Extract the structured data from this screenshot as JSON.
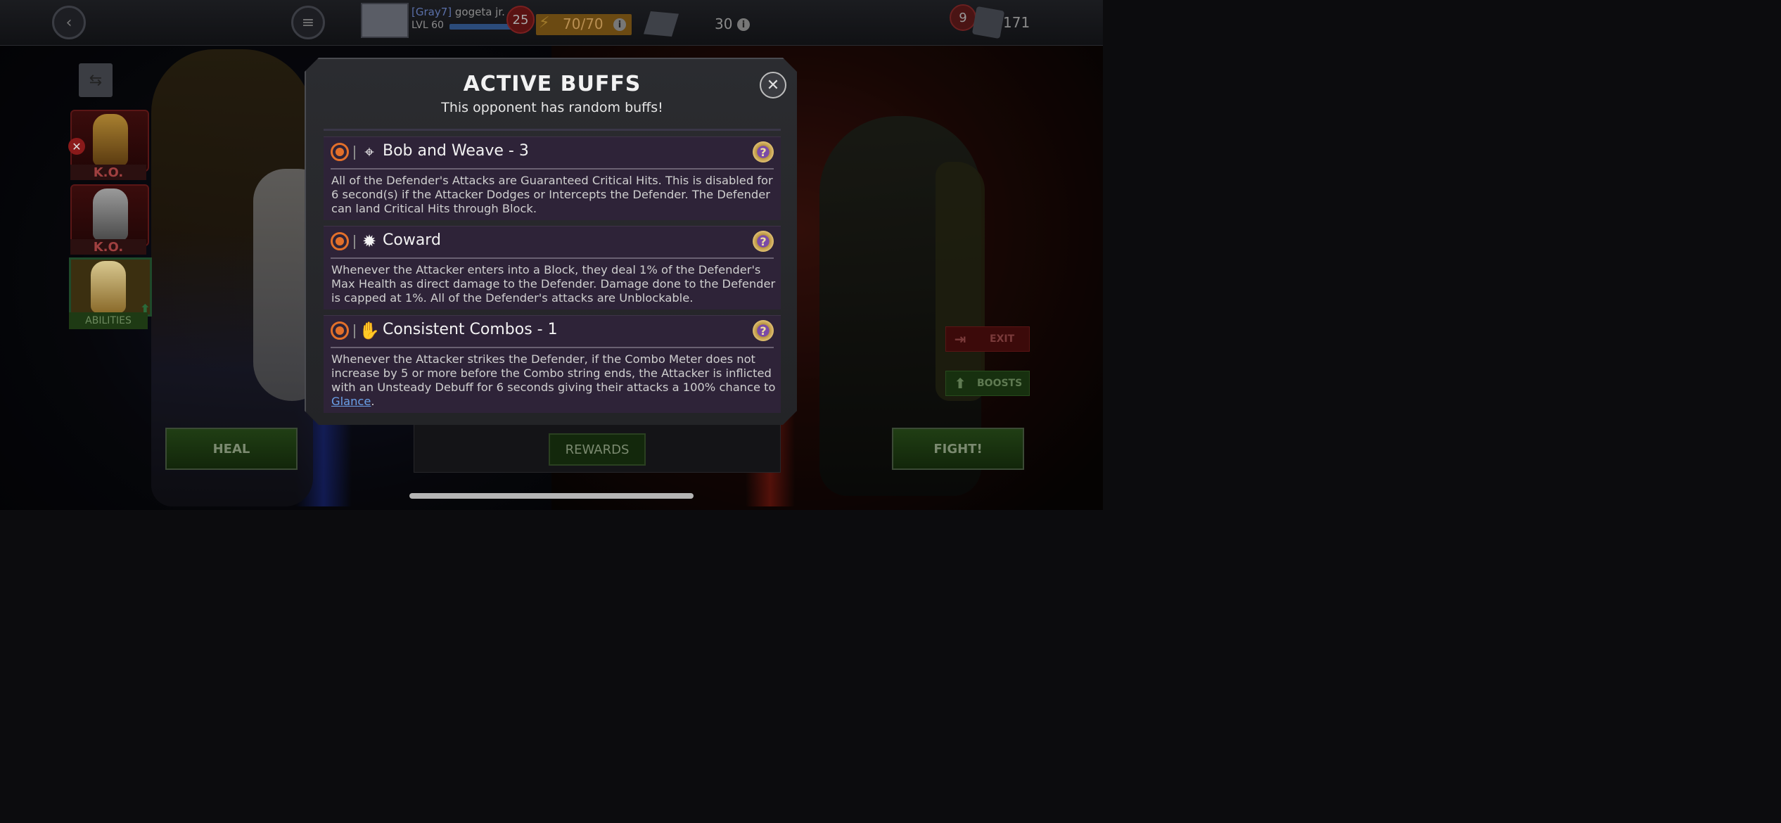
{
  "topbar": {
    "back_icon": "back-arrow-icon",
    "menu_icon": "menu-icon",
    "alliance_tag": "[Gray7]",
    "player_name": "gogeta jr.",
    "level_label": "LVL 60",
    "level_badge": "25",
    "energy": "70/70",
    "units_or_resource": "30",
    "notification_count": "9",
    "gold": "171"
  },
  "roster": {
    "ko_label_1": "K.O.",
    "ko_label_2": "K.O.",
    "abilities_label": "ABILITIES"
  },
  "side_buttons": {
    "exit_label": "EXIT",
    "boosts_label": "BOOSTS"
  },
  "bottom": {
    "heal_label": "HEAL",
    "rewards_label": "REWARDS",
    "fight_label": "FIGHT!"
  },
  "modal": {
    "title": "ACTIVE BUFFS",
    "subtitle": "This opponent has random buffs!",
    "buffs": [
      {
        "name": "Bob and Weave - 3",
        "type_icon": "crosshair-icon",
        "description": "All of the Defender's Attacks are Guaranteed Critical Hits. This is disabled for 6 second(s) if the Attacker Dodges or Intercepts the Defender. The Defender can land Critical Hits through Block."
      },
      {
        "name": "Coward",
        "type_icon": "burst-icon",
        "description": "Whenever the Attacker enters into a Block, they deal 1% of the Defender's Max Health as direct damage to the Defender. Damage done to the Defender is capped at 1%. All of the Defender's attacks are Unblockable."
      },
      {
        "name": "Consistent Combos - 1",
        "type_icon": "claw-icon",
        "description_prefix": "Whenever the Attacker strikes the Defender, if the Combo Meter does not increase by 5 or more before the Combo string ends, the Attacker is inflicted with an Unsteady Debuff for 6 seconds giving their attacks a 100% chance to ",
        "description_link": "Glance",
        "description_suffix": "."
      }
    ]
  },
  "colors": {
    "buff_accent": "#e3702a",
    "modal_bg": "#2b2c30",
    "buff_row_bg": "#2e2338",
    "link": "#6aa0e8"
  }
}
